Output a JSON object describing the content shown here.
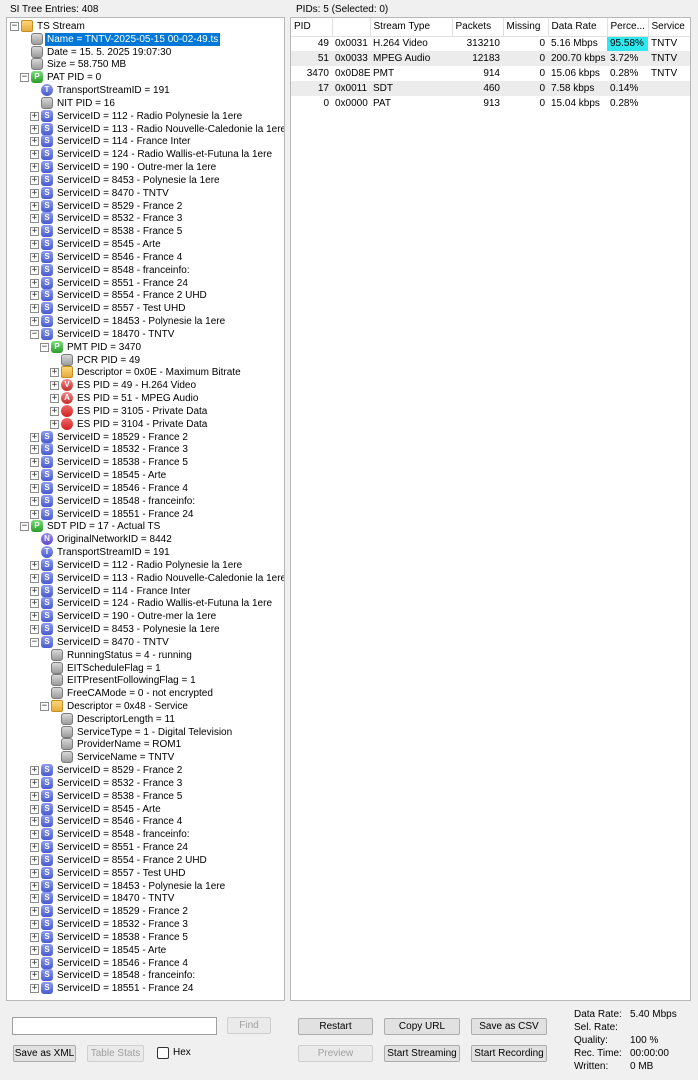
{
  "header": {
    "tree_entries": "SI Tree Entries: 408",
    "pids_info": "PIDs: 5   (Selected: 0)"
  },
  "tree": [
    {
      "depth": 0,
      "exp": "-",
      "icon": "folder",
      "label": "TS Stream"
    },
    {
      "depth": 1,
      "exp": "",
      "icon": "gray",
      "label": "Name = TNTV-2025-05-15 00-02-49.ts",
      "selected": true
    },
    {
      "depth": 1,
      "exp": "",
      "icon": "gray",
      "label": "Date = 15. 5. 2025 19:07:30"
    },
    {
      "depth": 1,
      "exp": "",
      "icon": "gray",
      "label": "Size = 58.750 MB"
    },
    {
      "depth": 1,
      "exp": "-",
      "icon": "P",
      "label": "PAT PID = 0"
    },
    {
      "depth": 2,
      "exp": "",
      "icon": "T",
      "label": "TransportStreamID = 191"
    },
    {
      "depth": 2,
      "exp": "",
      "icon": "gray",
      "label": "NIT PID = 16"
    },
    {
      "depth": 2,
      "exp": "+",
      "icon": "S",
      "label": "ServiceID = 112 - Radio Polynesie la 1ere"
    },
    {
      "depth": 2,
      "exp": "+",
      "icon": "S",
      "label": "ServiceID = 113 - Radio Nouvelle-Caledonie la 1ere"
    },
    {
      "depth": 2,
      "exp": "+",
      "icon": "S",
      "label": "ServiceID = 114 - France Inter"
    },
    {
      "depth": 2,
      "exp": "+",
      "icon": "S",
      "label": "ServiceID = 124 - Radio Wallis-et-Futuna la 1ere"
    },
    {
      "depth": 2,
      "exp": "+",
      "icon": "S",
      "label": "ServiceID = 190 - Outre-mer la 1ere"
    },
    {
      "depth": 2,
      "exp": "+",
      "icon": "S",
      "label": "ServiceID = 8453 - Polynesie la 1ere"
    },
    {
      "depth": 2,
      "exp": "+",
      "icon": "S",
      "label": "ServiceID = 8470 - TNTV"
    },
    {
      "depth": 2,
      "exp": "+",
      "icon": "S",
      "label": "ServiceID = 8529 - France 2"
    },
    {
      "depth": 2,
      "exp": "+",
      "icon": "S",
      "label": "ServiceID = 8532 - France 3"
    },
    {
      "depth": 2,
      "exp": "+",
      "icon": "S",
      "label": "ServiceID = 8538 - France 5"
    },
    {
      "depth": 2,
      "exp": "+",
      "icon": "S",
      "label": "ServiceID = 8545 - Arte"
    },
    {
      "depth": 2,
      "exp": "+",
      "icon": "S",
      "label": "ServiceID = 8546 - France 4"
    },
    {
      "depth": 2,
      "exp": "+",
      "icon": "S",
      "label": "ServiceID = 8548 - franceinfo:"
    },
    {
      "depth": 2,
      "exp": "+",
      "icon": "S",
      "label": "ServiceID = 8551 - France 24"
    },
    {
      "depth": 2,
      "exp": "+",
      "icon": "S",
      "label": "ServiceID = 8554 - France 2 UHD"
    },
    {
      "depth": 2,
      "exp": "+",
      "icon": "S",
      "label": "ServiceID = 8557 - Test UHD"
    },
    {
      "depth": 2,
      "exp": "+",
      "icon": "S",
      "label": "ServiceID = 18453 - Polynesie la 1ere"
    },
    {
      "depth": 2,
      "exp": "-",
      "icon": "S",
      "label": "ServiceID = 18470 - TNTV"
    },
    {
      "depth": 3,
      "exp": "-",
      "icon": "P",
      "label": "PMT PID = 3470"
    },
    {
      "depth": 4,
      "exp": "",
      "icon": "gray",
      "label": "PCR PID = 49"
    },
    {
      "depth": 4,
      "exp": "+",
      "icon": "folder",
      "label": "Descriptor = 0x0E - Maximum Bitrate"
    },
    {
      "depth": 4,
      "exp": "+",
      "icon": "V",
      "label": "ES PID = 49 - H.264 Video"
    },
    {
      "depth": 4,
      "exp": "+",
      "icon": "A",
      "label": "ES PID = 51 - MPEG Audio"
    },
    {
      "depth": 4,
      "exp": "+",
      "icon": "red",
      "label": "ES PID = 3105 - Private Data"
    },
    {
      "depth": 4,
      "exp": "+",
      "icon": "red",
      "label": "ES PID = 3104 - Private Data"
    },
    {
      "depth": 2,
      "exp": "+",
      "icon": "S",
      "label": "ServiceID = 18529 - France 2"
    },
    {
      "depth": 2,
      "exp": "+",
      "icon": "S",
      "label": "ServiceID = 18532 - France 3"
    },
    {
      "depth": 2,
      "exp": "+",
      "icon": "S",
      "label": "ServiceID = 18538 - France 5"
    },
    {
      "depth": 2,
      "exp": "+",
      "icon": "S",
      "label": "ServiceID = 18545 - Arte"
    },
    {
      "depth": 2,
      "exp": "+",
      "icon": "S",
      "label": "ServiceID = 18546 - France 4"
    },
    {
      "depth": 2,
      "exp": "+",
      "icon": "S",
      "label": "ServiceID = 18548 - franceinfo:"
    },
    {
      "depth": 2,
      "exp": "+",
      "icon": "S",
      "label": "ServiceID = 18551 - France 24"
    },
    {
      "depth": 1,
      "exp": "-",
      "icon": "P",
      "label": "SDT PID = 17 - Actual TS"
    },
    {
      "depth": 2,
      "exp": "",
      "icon": "N",
      "label": "OriginalNetworkID = 8442"
    },
    {
      "depth": 2,
      "exp": "",
      "icon": "T",
      "label": "TransportStreamID = 191"
    },
    {
      "depth": 2,
      "exp": "+",
      "icon": "S",
      "label": "ServiceID = 112 - Radio Polynesie la 1ere"
    },
    {
      "depth": 2,
      "exp": "+",
      "icon": "S",
      "label": "ServiceID = 113 - Radio Nouvelle-Caledonie la 1ere"
    },
    {
      "depth": 2,
      "exp": "+",
      "icon": "S",
      "label": "ServiceID = 114 - France Inter"
    },
    {
      "depth": 2,
      "exp": "+",
      "icon": "S",
      "label": "ServiceID = 124 - Radio Wallis-et-Futuna la 1ere"
    },
    {
      "depth": 2,
      "exp": "+",
      "icon": "S",
      "label": "ServiceID = 190 - Outre-mer la 1ere"
    },
    {
      "depth": 2,
      "exp": "+",
      "icon": "S",
      "label": "ServiceID = 8453 - Polynesie la 1ere"
    },
    {
      "depth": 2,
      "exp": "-",
      "icon": "S",
      "label": "ServiceID = 8470 - TNTV"
    },
    {
      "depth": 3,
      "exp": "",
      "icon": "gray",
      "label": "RunningStatus = 4 - running"
    },
    {
      "depth": 3,
      "exp": "",
      "icon": "gray",
      "label": "EITScheduleFlag = 1"
    },
    {
      "depth": 3,
      "exp": "",
      "icon": "gray",
      "label": "EITPresentFollowingFlag = 1"
    },
    {
      "depth": 3,
      "exp": "",
      "icon": "gray",
      "label": "FreeCAMode = 0 - not encrypted"
    },
    {
      "depth": 3,
      "exp": "-",
      "icon": "folder",
      "label": "Descriptor = 0x48 - Service"
    },
    {
      "depth": 4,
      "exp": "",
      "icon": "gray",
      "label": "DescriptorLength = 11"
    },
    {
      "depth": 4,
      "exp": "",
      "icon": "gray",
      "label": "ServiceType = 1 - Digital Television"
    },
    {
      "depth": 4,
      "exp": "",
      "icon": "gray",
      "label": "ProviderName = ROM1"
    },
    {
      "depth": 4,
      "exp": "",
      "icon": "gray",
      "label": "ServiceName = TNTV"
    },
    {
      "depth": 2,
      "exp": "+",
      "icon": "S",
      "label": "ServiceID = 8529 - France 2"
    },
    {
      "depth": 2,
      "exp": "+",
      "icon": "S",
      "label": "ServiceID = 8532 - France 3"
    },
    {
      "depth": 2,
      "exp": "+",
      "icon": "S",
      "label": "ServiceID = 8538 - France 5"
    },
    {
      "depth": 2,
      "exp": "+",
      "icon": "S",
      "label": "ServiceID = 8545 - Arte"
    },
    {
      "depth": 2,
      "exp": "+",
      "icon": "S",
      "label": "ServiceID = 8546 - France 4"
    },
    {
      "depth": 2,
      "exp": "+",
      "icon": "S",
      "label": "ServiceID = 8548 - franceinfo:"
    },
    {
      "depth": 2,
      "exp": "+",
      "icon": "S",
      "label": "ServiceID = 8551 - France 24"
    },
    {
      "depth": 2,
      "exp": "+",
      "icon": "S",
      "label": "ServiceID = 8554 - France 2 UHD"
    },
    {
      "depth": 2,
      "exp": "+",
      "icon": "S",
      "label": "ServiceID = 8557 - Test UHD"
    },
    {
      "depth": 2,
      "exp": "+",
      "icon": "S",
      "label": "ServiceID = 18453 - Polynesie la 1ere"
    },
    {
      "depth": 2,
      "exp": "+",
      "icon": "S",
      "label": "ServiceID = 18470 - TNTV"
    },
    {
      "depth": 2,
      "exp": "+",
      "icon": "S",
      "label": "ServiceID = 18529 - France 2"
    },
    {
      "depth": 2,
      "exp": "+",
      "icon": "S",
      "label": "ServiceID = 18532 - France 3"
    },
    {
      "depth": 2,
      "exp": "+",
      "icon": "S",
      "label": "ServiceID = 18538 - France 5"
    },
    {
      "depth": 2,
      "exp": "+",
      "icon": "S",
      "label": "ServiceID = 18545 - Arte"
    },
    {
      "depth": 2,
      "exp": "+",
      "icon": "S",
      "label": "ServiceID = 18546 - France 4"
    },
    {
      "depth": 2,
      "exp": "+",
      "icon": "S",
      "label": "ServiceID = 18548 - franceinfo:"
    },
    {
      "depth": 2,
      "exp": "+",
      "icon": "S",
      "label": "ServiceID = 18551 - France 24"
    }
  ],
  "pid_table": {
    "columns": [
      "PID",
      "",
      "Stream Type",
      "Packets",
      "Missing",
      "Data Rate",
      "Perce...",
      "Service"
    ],
    "rows": [
      [
        "49",
        "0x0031",
        "H.264 Video",
        "313210",
        "0",
        "5.16 Mbps",
        "95.58%",
        "TNTV"
      ],
      [
        "51",
        "0x0033",
        "MPEG Audio",
        "12183",
        "0",
        "200.70 kbps",
        "3.72%",
        "TNTV"
      ],
      [
        "3470",
        "0x0D8E",
        "PMT",
        "914",
        "0",
        "15.06 kbps",
        "0.28%",
        "TNTV"
      ],
      [
        "17",
        "0x0011",
        "SDT",
        "460",
        "0",
        "7.58 kbps",
        "0.14%",
        ""
      ],
      [
        "0",
        "0x0000",
        "PAT",
        "913",
        "0",
        "15.04 kbps",
        "0.28%",
        ""
      ]
    ],
    "highlight_color": "#2ee8f0"
  },
  "controls": {
    "search_value": "",
    "find": "Find",
    "save_xml": "Save as XML",
    "table_stats": "Table Stats",
    "hex": "Hex",
    "restart": "Restart",
    "copy_url": "Copy URL",
    "save_csv": "Save as CSV",
    "preview": "Preview",
    "start_streaming": "Start Streaming",
    "start_recording": "Start Recording"
  },
  "stats": [
    {
      "label": "Data Rate:",
      "value": "5.40 Mbps"
    },
    {
      "label": "Sel. Rate:",
      "value": ""
    },
    {
      "label": "Quality:",
      "value": "100 %"
    },
    {
      "label": "Rec. Time:",
      "value": "00:00:00"
    },
    {
      "label": "Written:",
      "value": "0 MB"
    }
  ]
}
